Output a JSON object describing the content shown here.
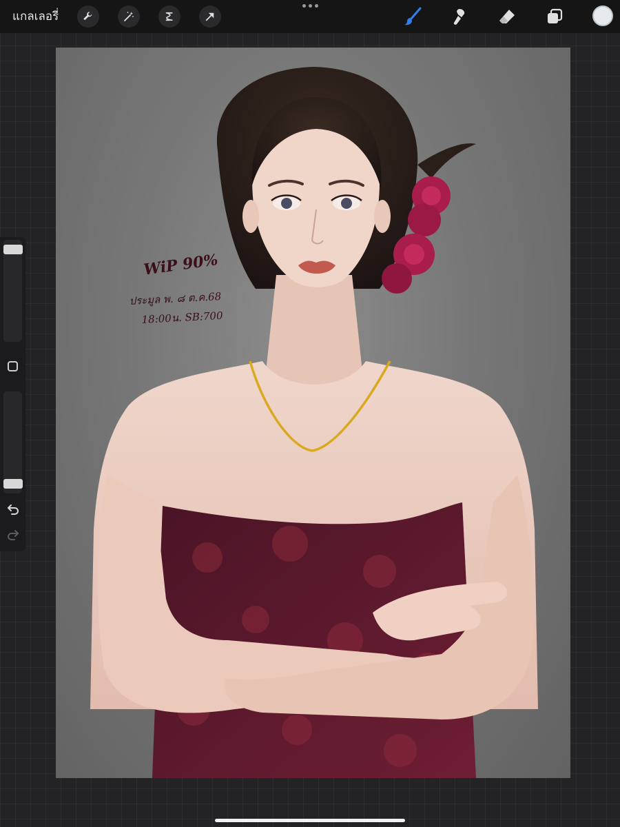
{
  "toolbar": {
    "gallery_label": "แกลเลอรี่",
    "left_tools": [
      {
        "icon": "wrench-icon",
        "name": "actions"
      },
      {
        "icon": "magic-wand-icon",
        "name": "adjustments"
      },
      {
        "icon": "selection-icon",
        "name": "selection"
      },
      {
        "icon": "arrow-icon",
        "name": "transform"
      }
    ],
    "right_tools": [
      {
        "icon": "brush-icon",
        "name": "paint",
        "active": true
      },
      {
        "icon": "smudge-icon",
        "name": "smudge"
      },
      {
        "icon": "eraser-icon",
        "name": "erase"
      },
      {
        "icon": "layers-icon",
        "name": "layers"
      }
    ],
    "active_color": "#e6eaed",
    "active_tool_color": "#2f7ef2"
  },
  "sidebar": {
    "brush_size_level": 0.05,
    "opacity_level": 0.95,
    "undo_icon": "undo-icon",
    "redo_icon": "redo-icon"
  },
  "canvas": {
    "annotation_title": "WiP 90%",
    "annotation_line1": "ประมูล พ. ๘ ต.ค.68",
    "annotation_line2": "18:00น. SB:700",
    "artwork": "digital-portrait-woman"
  }
}
